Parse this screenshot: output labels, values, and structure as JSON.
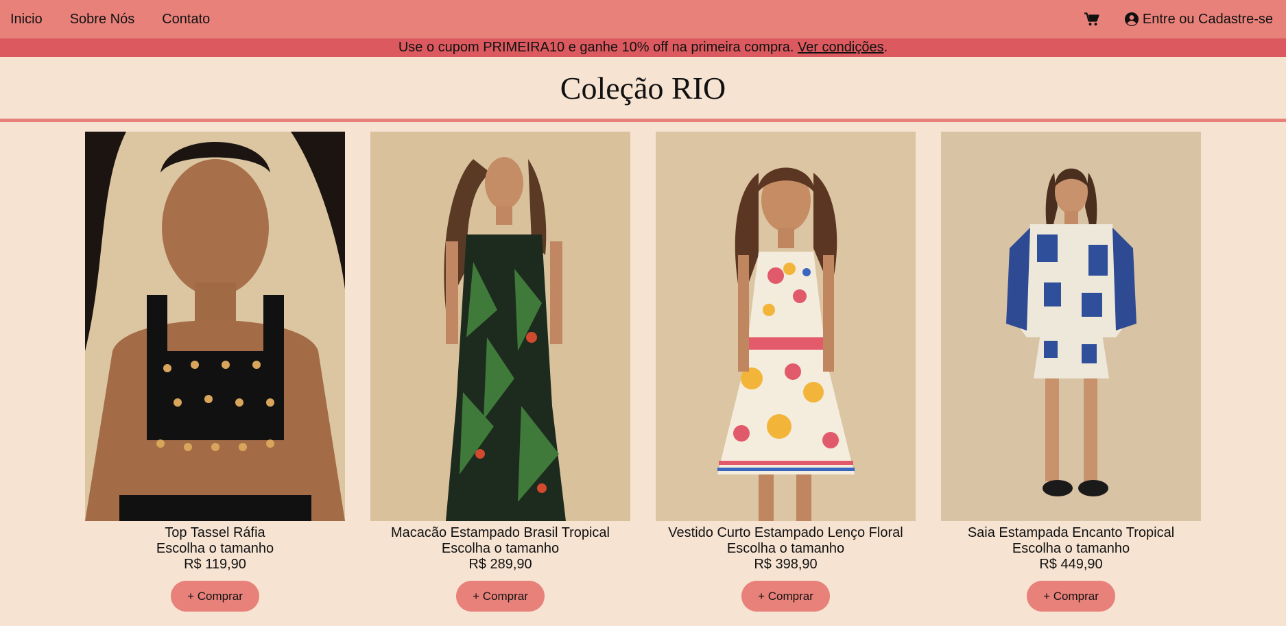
{
  "nav": {
    "links": [
      "Inicio",
      "Sobre Nós",
      "Contato"
    ],
    "account_label": "Entre ou Cadastre-se",
    "cart_icon": "cart-icon",
    "account_icon": "user-circle-icon"
  },
  "promo": {
    "text": "Use o cupom PRIMEIRA10 e ganhe 10% off na primeira compra. ",
    "link": "Ver condições",
    "suffix": "."
  },
  "collection": {
    "title": "Coleção RIO"
  },
  "products": [
    {
      "name": "Top Tassel Ráfia",
      "size_label": "Escolha o tamanho",
      "price": "R$ 119,90",
      "buy_label": "+ Comprar"
    },
    {
      "name": "Macacão Estampado Brasil Tropical",
      "size_label": "Escolha o tamanho",
      "price": "R$ 289,90",
      "buy_label": "+ Comprar"
    },
    {
      "name": "Vestido Curto Estampado Lenço Floral",
      "size_label": "Escolha o tamanho",
      "price": "R$ 398,90",
      "buy_label": "+ Comprar"
    },
    {
      "name": "Saia Estampada Encanto Tropical",
      "size_label": "Escolha o tamanho",
      "price": "R$ 449,90",
      "buy_label": "+ Comprar"
    }
  ],
  "colors": {
    "nav_bg": "#e8817a",
    "promo_bg": "#dc5a5f",
    "page_bg": "#f6e3d2",
    "button_bg": "#e8817a"
  }
}
